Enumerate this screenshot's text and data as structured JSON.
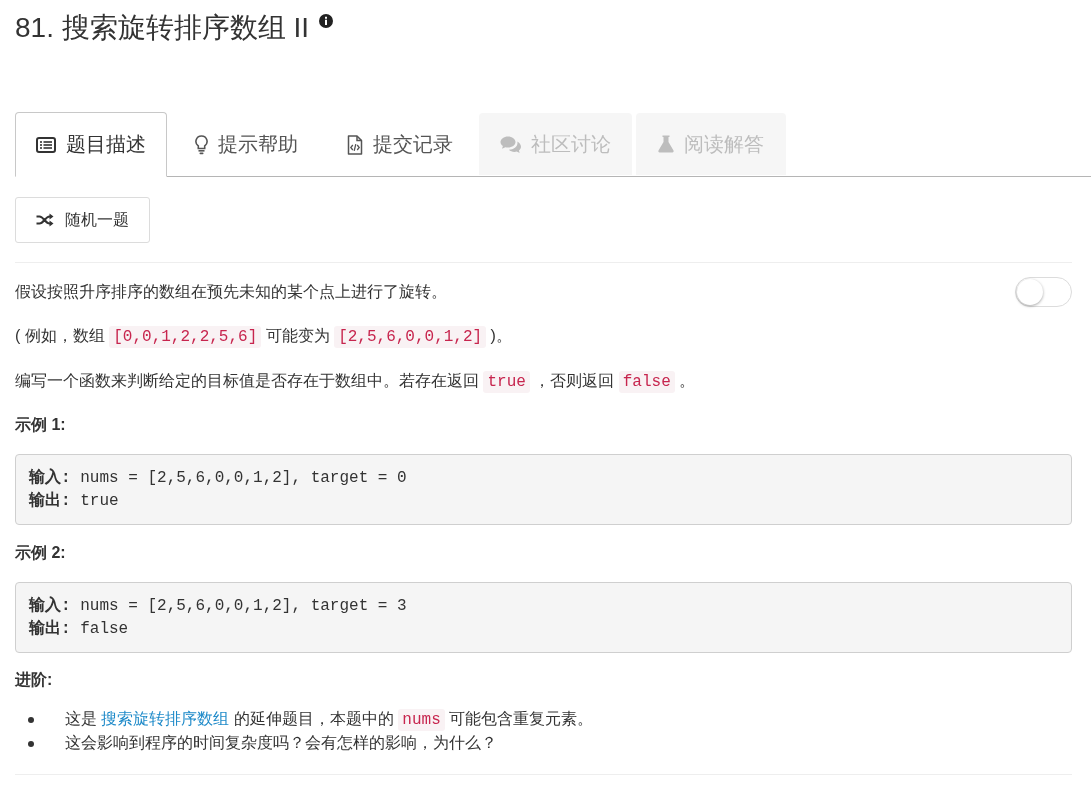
{
  "title": {
    "text": "81. 搜索旋转排序数组 II"
  },
  "tabs": [
    {
      "label": "题目描述",
      "selected": true,
      "disabled": false
    },
    {
      "label": "提示帮助",
      "selected": false,
      "disabled": false
    },
    {
      "label": "提交记录",
      "selected": false,
      "disabled": false
    },
    {
      "label": "社区讨论",
      "selected": false,
      "disabled": true
    },
    {
      "label": "阅读解答",
      "selected": false,
      "disabled": true
    }
  ],
  "random_button": {
    "label": "随机一题"
  },
  "toggle": {
    "on": false
  },
  "paragraphs": [
    {
      "segments": [
        {
          "kind": "text",
          "text": "假设按照升序排序的数组在预先未知的某个点上进行了旋转。"
        }
      ]
    },
    {
      "segments": [
        {
          "kind": "text",
          "text": "( 例如，数组 "
        },
        {
          "kind": "code",
          "text": "[0,0,1,2,2,5,6]"
        },
        {
          "kind": "text",
          "text": " 可能变为 "
        },
        {
          "kind": "code",
          "text": "[2,5,6,0,0,1,2]"
        },
        {
          "kind": "text",
          "text": " )。"
        }
      ]
    },
    {
      "segments": [
        {
          "kind": "text",
          "text": "编写一个函数来判断给定的目标值是否存在于数组中。若存在返回 "
        },
        {
          "kind": "code",
          "text": "true"
        },
        {
          "kind": "text",
          "text": " ，否则返回 "
        },
        {
          "kind": "code",
          "text": "false"
        },
        {
          "kind": "text",
          "text": " 。"
        }
      ]
    }
  ],
  "examples": [
    {
      "heading": "示例 1:",
      "lines": [
        "**输入:** nums = [2,5,6,0,0,1,2], target = 0",
        "**输出:** true"
      ]
    },
    {
      "heading": "示例 2:",
      "lines": [
        "**输入:** nums = [2,5,6,0,0,1,2], target = 3",
        "**输出:** false"
      ]
    }
  ],
  "advanced": {
    "heading": "进阶:",
    "items": [
      {
        "segments": [
          {
            "kind": "text",
            "text": "这是 "
          },
          {
            "kind": "link",
            "text": "搜索旋转排序数组"
          },
          {
            "kind": "text",
            "text": " 的延伸题目，本题中的 "
          },
          {
            "kind": "code",
            "text": "nums"
          },
          {
            "kind": "text",
            "text": " 可能包含重复元素。"
          }
        ]
      },
      {
        "segments": [
          {
            "kind": "text",
            "text": "这会影响到程序的时间复杂度吗？会有怎样的影响，为什么？"
          }
        ]
      }
    ]
  }
}
